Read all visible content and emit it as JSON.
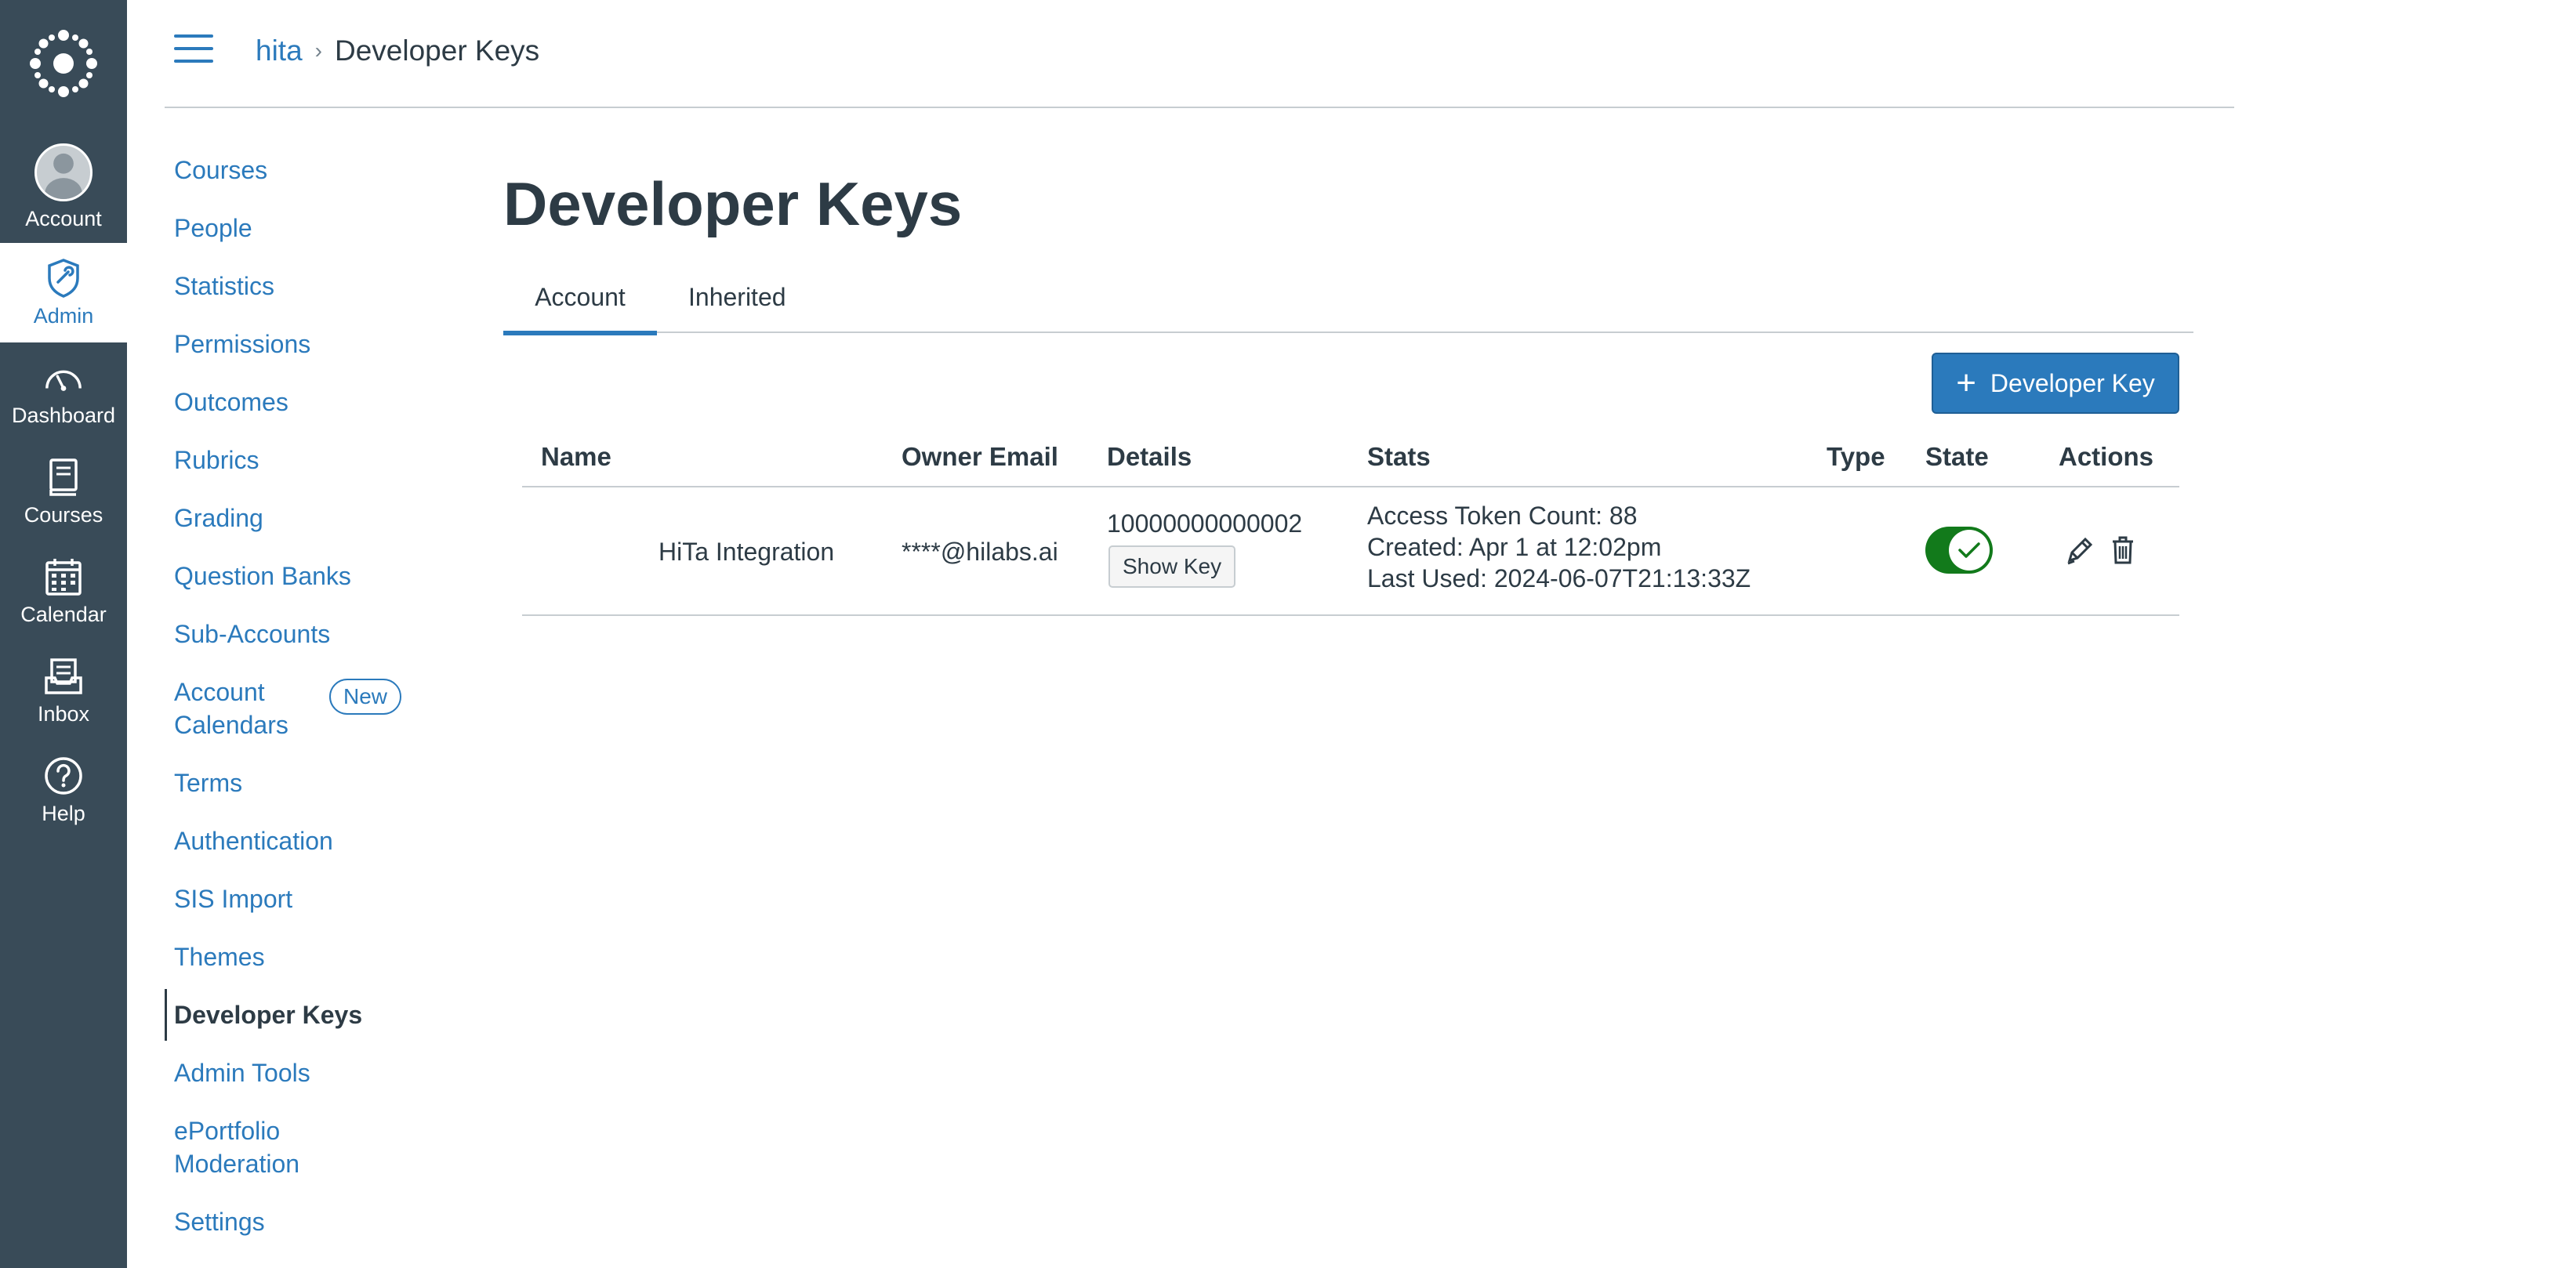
{
  "global_nav": {
    "items": [
      {
        "label": "Account",
        "icon": "avatar"
      },
      {
        "label": "Admin",
        "icon": "admin-shield-icon"
      },
      {
        "label": "Dashboard",
        "icon": "dashboard-icon"
      },
      {
        "label": "Courses",
        "icon": "courses-icon"
      },
      {
        "label": "Calendar",
        "icon": "calendar-icon"
      },
      {
        "label": "Inbox",
        "icon": "inbox-icon"
      },
      {
        "label": "Help",
        "icon": "help-icon"
      }
    ],
    "active": "Admin",
    "colors": {
      "background": "#394b58",
      "accent": "#2b7abc"
    }
  },
  "header": {
    "breadcrumb": {
      "root": "hita",
      "separator": "›",
      "current": "Developer Keys"
    }
  },
  "sub_nav": {
    "items": [
      {
        "label": "Courses"
      },
      {
        "label": "People"
      },
      {
        "label": "Statistics"
      },
      {
        "label": "Permissions"
      },
      {
        "label": "Outcomes"
      },
      {
        "label": "Rubrics"
      },
      {
        "label": "Grading"
      },
      {
        "label": "Question Banks"
      },
      {
        "label": "Sub-Accounts"
      },
      {
        "label": "Account\nCalendars",
        "badge": "New"
      },
      {
        "label": "Terms"
      },
      {
        "label": "Authentication"
      },
      {
        "label": "SIS Import"
      },
      {
        "label": "Themes"
      },
      {
        "label": "Developer Keys",
        "active": true
      },
      {
        "label": "Admin Tools"
      },
      {
        "label": "ePortfolio\nModeration"
      },
      {
        "label": "Settings"
      }
    ]
  },
  "main": {
    "title": "Developer Keys",
    "tabs": [
      {
        "label": "Account",
        "active": true
      },
      {
        "label": "Inherited",
        "active": false
      }
    ],
    "add_button_label": "Developer Key",
    "table": {
      "headers": [
        "Name",
        "Owner Email",
        "Details",
        "Stats",
        "Type",
        "State",
        "Actions"
      ],
      "rows": [
        {
          "name": "HiTa Integration",
          "owner_email": "****@hilabs.ai",
          "details_id": "10000000000002",
          "show_key_label": "Show Key",
          "stats": {
            "access_token_count": "Access Token Count: 88",
            "created": "Created: Apr 1 at 12:02pm",
            "last_used": "Last Used: 2024-06-07T21:13:33Z"
          },
          "type": "",
          "state_on": true,
          "state_color": "#127a1b"
        }
      ]
    }
  }
}
